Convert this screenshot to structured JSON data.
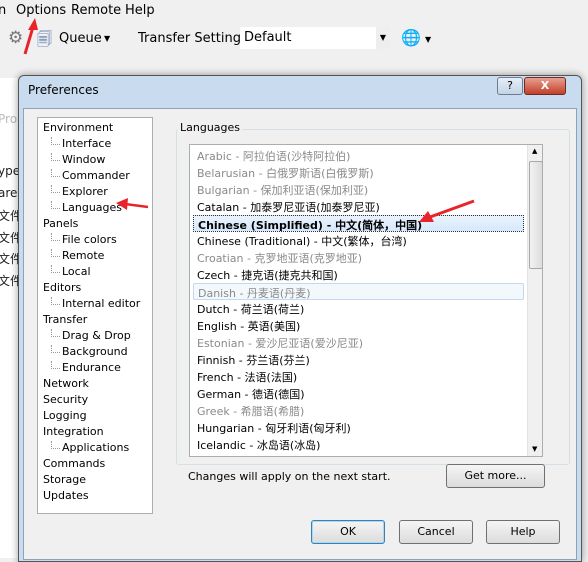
{
  "menu": {
    "items": [
      "n",
      "Options",
      "Remote",
      "Help"
    ]
  },
  "toolbar": {
    "queue_label": "Queue",
    "transfer_settings_label": "Transfer Settings",
    "transfer_settings_value": "Default"
  },
  "background": {
    "items": [
      "Prop",
      "ype",
      "are",
      "文件夹",
      "文件夹",
      "文件夹",
      "文件夹"
    ]
  },
  "dialog": {
    "title": "Preferences",
    "help_glyph": "?",
    "close_glyph": "X",
    "tree": [
      {
        "label": "Environment",
        "level": 0
      },
      {
        "label": "Interface",
        "level": 1
      },
      {
        "label": "Window",
        "level": 1
      },
      {
        "label": "Commander",
        "level": 1
      },
      {
        "label": "Explorer",
        "level": 1
      },
      {
        "label": "Languages",
        "level": 1,
        "selected": true
      },
      {
        "label": "Panels",
        "level": 0
      },
      {
        "label": "File colors",
        "level": 1
      },
      {
        "label": "Remote",
        "level": 1
      },
      {
        "label": "Local",
        "level": 1
      },
      {
        "label": "Editors",
        "level": 0
      },
      {
        "label": "Internal editor",
        "level": 1
      },
      {
        "label": "Transfer",
        "level": 0
      },
      {
        "label": "Drag & Drop",
        "level": 1
      },
      {
        "label": "Background",
        "level": 1
      },
      {
        "label": "Endurance",
        "level": 1
      },
      {
        "label": "Network",
        "level": 0
      },
      {
        "label": "Security",
        "level": 0
      },
      {
        "label": "Logging",
        "level": 0
      },
      {
        "label": "Integration",
        "level": 0
      },
      {
        "label": "Applications",
        "level": 1
      },
      {
        "label": "Commands",
        "level": 0
      },
      {
        "label": "Storage",
        "level": 0
      },
      {
        "label": "Updates",
        "level": 0
      }
    ],
    "languages_group": "Languages",
    "languages": [
      {
        "label": "Arabic - 阿拉伯语(沙特阿拉伯)",
        "state": "dis"
      },
      {
        "label": "Belarusian - 白俄罗斯语(白俄罗斯)",
        "state": "dis"
      },
      {
        "label": "Bulgarian - 保加利亚语(保加利亚)",
        "state": "dis"
      },
      {
        "label": "Catalan - 加泰罗尼亚语(加泰罗尼亚)",
        "state": ""
      },
      {
        "label": "Chinese (Simplified) - 中文(简体，中国)",
        "state": "sel"
      },
      {
        "label": "Chinese (Traditional) - 中文(繁体，台湾)",
        "state": ""
      },
      {
        "label": "Croatian - 克罗地亚语(克罗地亚)",
        "state": "dis"
      },
      {
        "label": "Czech - 捷克语(捷克共和国)",
        "state": ""
      },
      {
        "label": "Danish - 丹麦语(丹麦)",
        "state": "dis hov"
      },
      {
        "label": "Dutch - 荷兰语(荷兰)",
        "state": ""
      },
      {
        "label": "English - 英语(美国)",
        "state": ""
      },
      {
        "label": "Estonian - 爱沙尼亚语(爱沙尼亚)",
        "state": "dis"
      },
      {
        "label": "Finnish - 芬兰语(芬兰)",
        "state": ""
      },
      {
        "label": "French - 法语(法国)",
        "state": ""
      },
      {
        "label": "German - 德语(德国)",
        "state": ""
      },
      {
        "label": "Greek - 希腊语(希腊)",
        "state": "dis"
      },
      {
        "label": "Hungarian - 匈牙利语(匈牙利)",
        "state": ""
      },
      {
        "label": "Icelandic - 冰岛语(冰岛)",
        "state": ""
      }
    ],
    "note": "Changes will apply on the next start.",
    "get_more": "Get more...",
    "ok": "OK",
    "cancel": "Cancel",
    "help": "Help"
  },
  "colors": {
    "annotation_arrow": "#e8242a",
    "selection": "#d6e8fb"
  }
}
